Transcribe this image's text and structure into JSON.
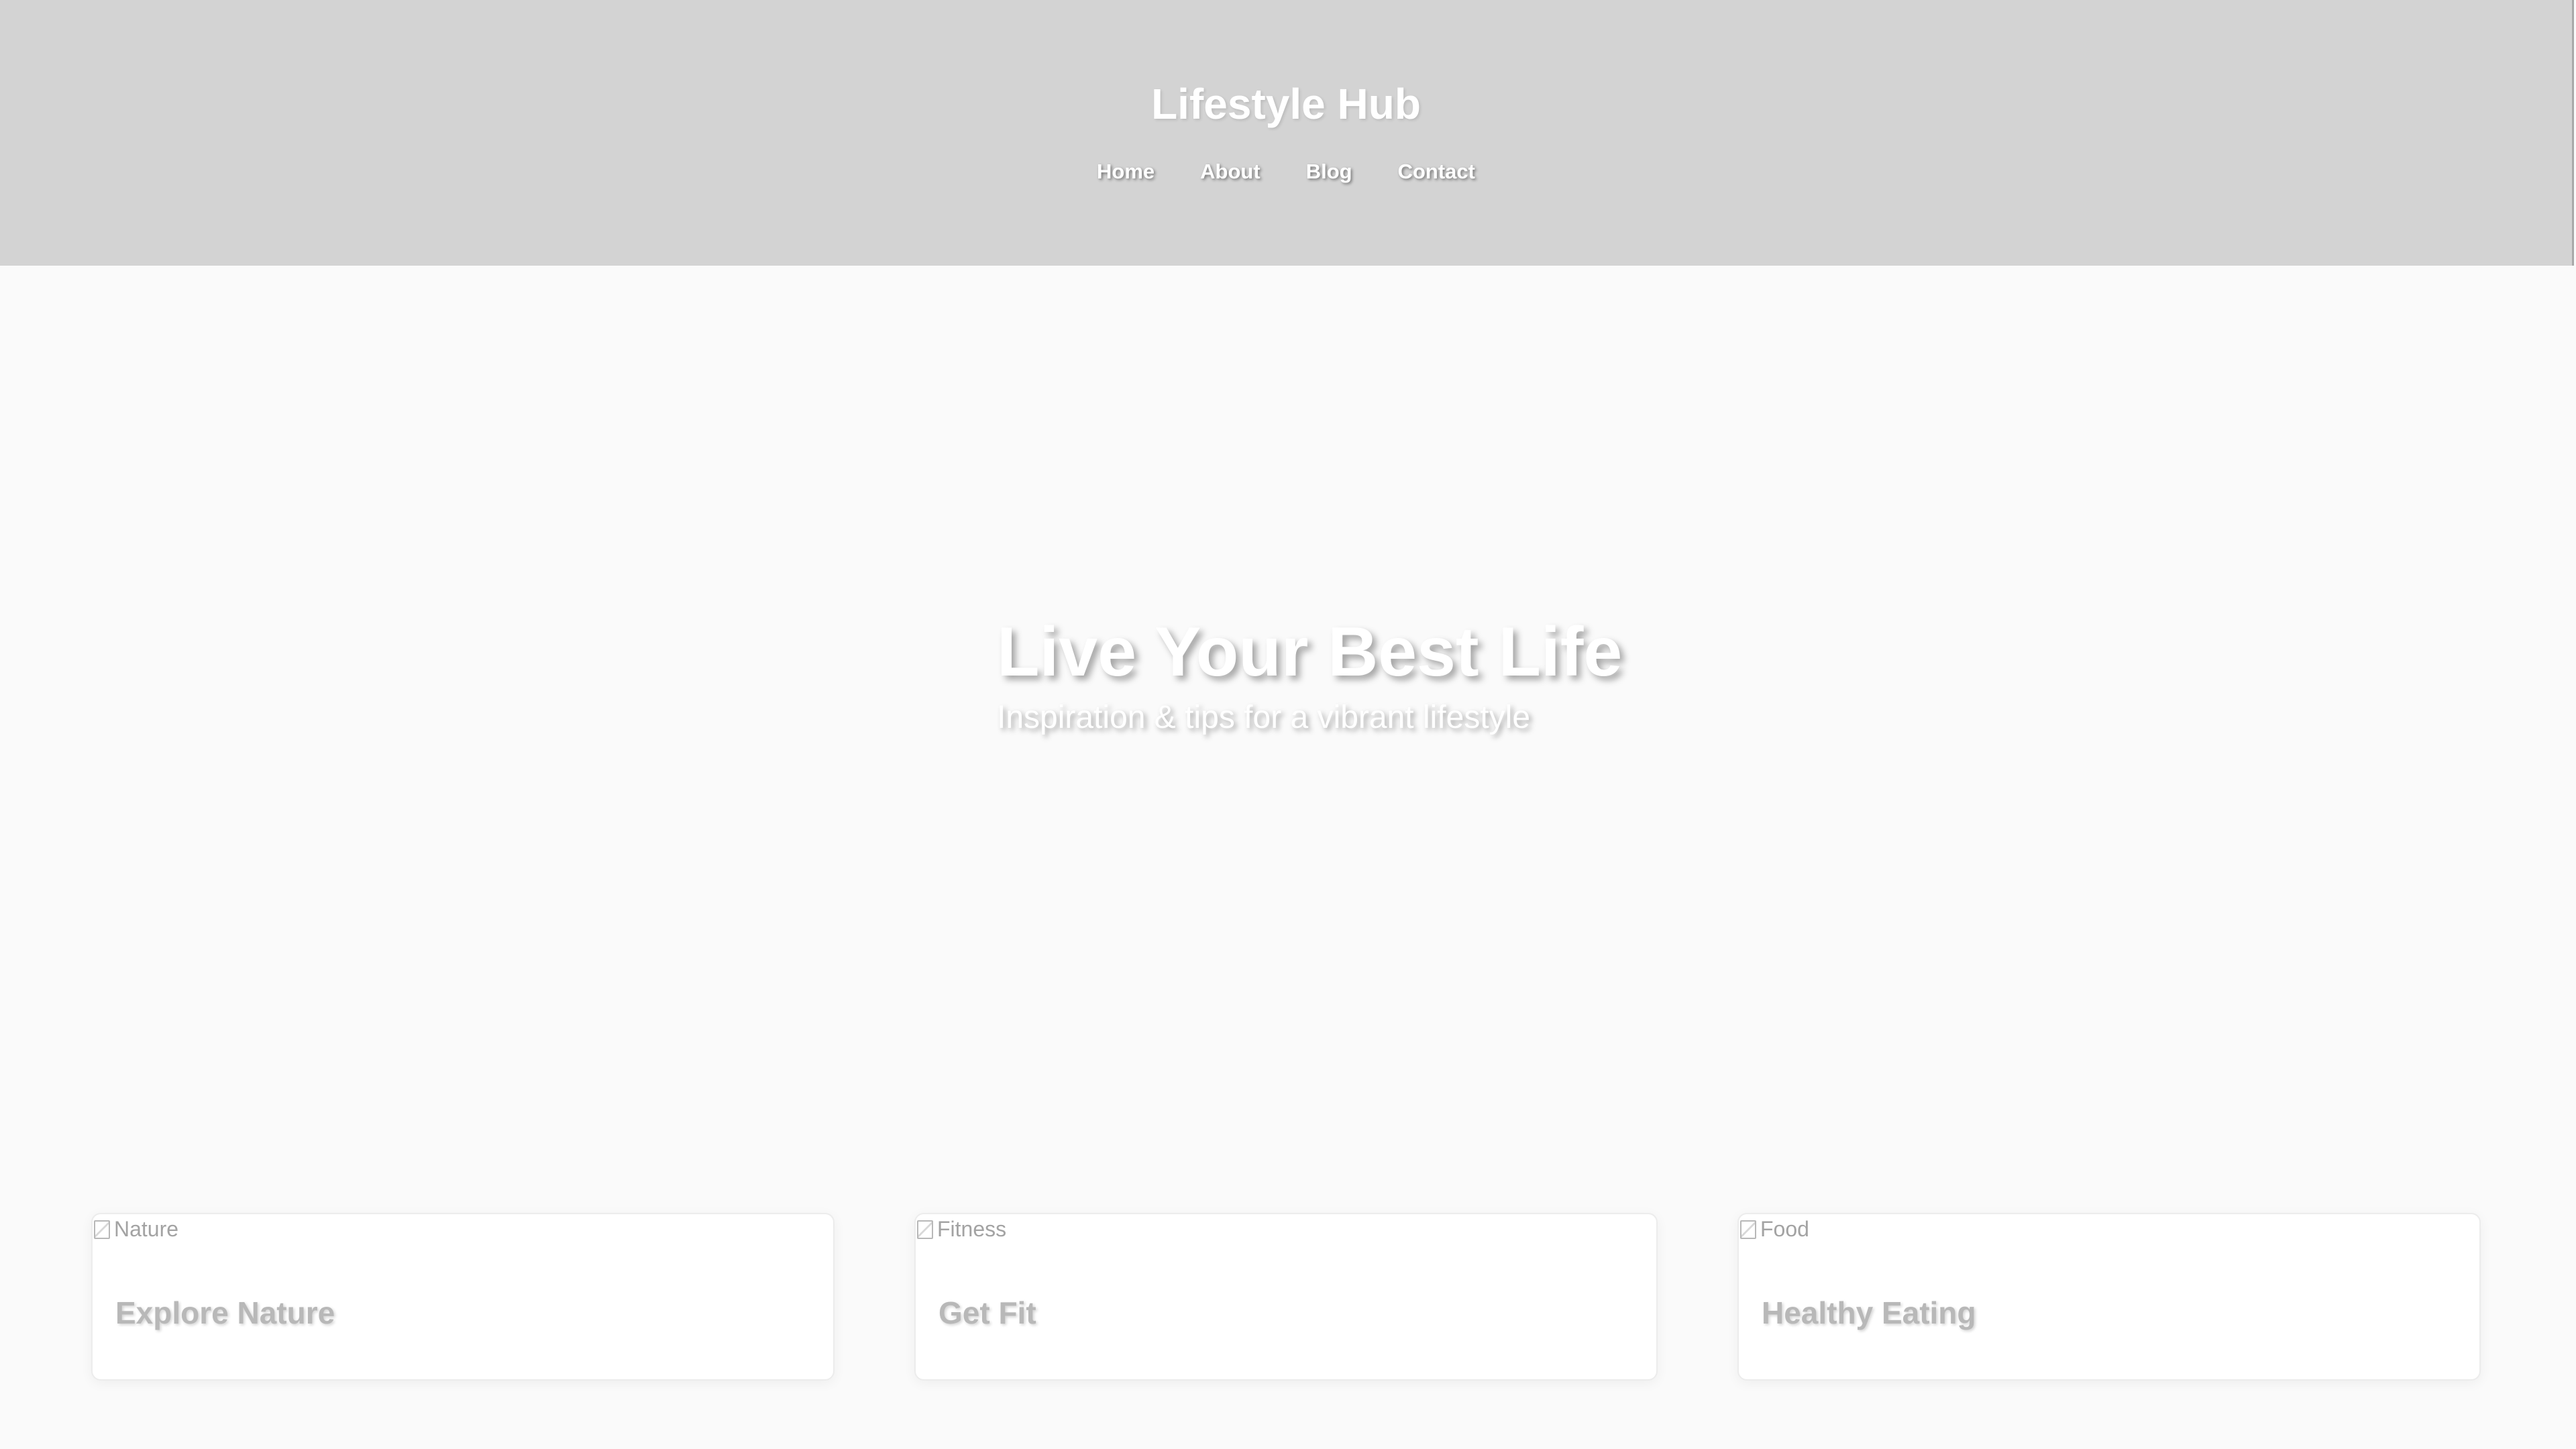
{
  "header": {
    "title": "Lifestyle Hub",
    "nav": [
      {
        "label": "Home"
      },
      {
        "label": "About"
      },
      {
        "label": "Blog"
      },
      {
        "label": "Contact"
      }
    ]
  },
  "hero": {
    "title": "Live Your Best Life",
    "subtitle": "Inspiration & tips for a vibrant lifestyle"
  },
  "cards": [
    {
      "image_alt": "Nature",
      "image_icon": "broken-image-icon",
      "title": "Explore Nature"
    },
    {
      "image_alt": "Fitness",
      "image_icon": "broken-image-icon",
      "title": "Get Fit"
    },
    {
      "image_alt": "Food",
      "image_icon": "broken-image-icon",
      "title": "Healthy Eating"
    }
  ],
  "colors": {
    "header_bg": "#d3d3d3",
    "page_bg": "#fafafa",
    "card_bg": "#ffffff",
    "heading_text": "#ffffff",
    "card_title_text": "#b8b8b8",
    "alt_text": "#a3a3a3"
  }
}
